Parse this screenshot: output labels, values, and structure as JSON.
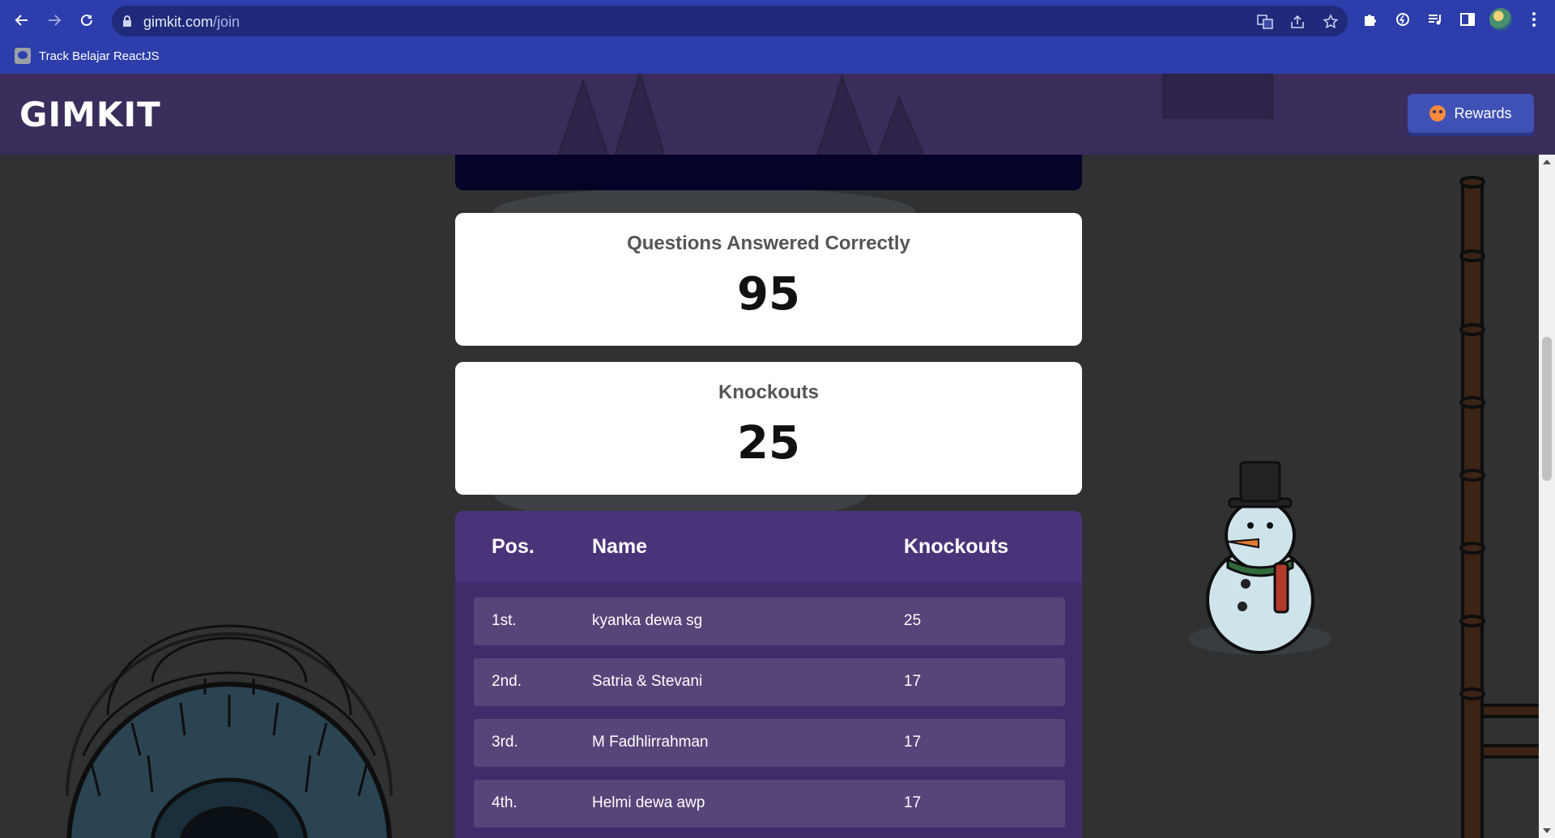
{
  "browser": {
    "url_domain": "gimkit.com",
    "url_path": "/join",
    "bookmark": "Track Belajar ReactJS"
  },
  "header": {
    "logo": "GIMKIT",
    "rewards_label": "Rewards"
  },
  "stats": [
    {
      "label": "Questions Answered Correctly",
      "value": "95"
    },
    {
      "label": "Knockouts",
      "value": "25"
    }
  ],
  "leaderboard": {
    "headers": {
      "pos": "Pos.",
      "name": "Name",
      "knockouts": "Knockouts"
    },
    "rows": [
      {
        "pos": "1st.",
        "name": "kyanka dewa sg",
        "knockouts": "25"
      },
      {
        "pos": "2nd.",
        "name": "Satria & Stevani",
        "knockouts": "17"
      },
      {
        "pos": "3rd.",
        "name": "M Fadhlirrahman",
        "knockouts": "17"
      },
      {
        "pos": "4th.",
        "name": "Helmi dewa awp",
        "knockouts": "17"
      }
    ]
  },
  "colors": {
    "chrome": "#2d3dab",
    "header": "#3a2d5c",
    "board": "#3f2d6b",
    "row": "#574479",
    "rewards": "#3f51b5"
  }
}
